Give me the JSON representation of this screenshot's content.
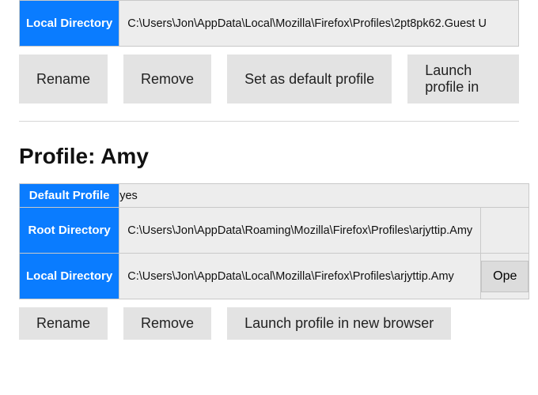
{
  "profiles": [
    {
      "heading": "",
      "rows": {
        "root_directory_label": "",
        "root_directory_value": "",
        "local_directory_label": "Local Directory",
        "local_directory_value": "C:\\Users\\Jon\\AppData\\Local\\Mozilla\\Firefox\\Profiles\\2pt8pk62.Guest U"
      },
      "buttons": {
        "rename": "Rename",
        "remove": "Remove",
        "set_default": "Set as default profile",
        "launch": "Launch profile in"
      }
    },
    {
      "heading": "Profile: Amy",
      "rows": {
        "default_profile_label": "Default Profile",
        "default_profile_value": "yes",
        "root_directory_label": "Root Directory",
        "root_directory_value": "C:\\Users\\Jon\\AppData\\Roaming\\Mozilla\\Firefox\\Profiles\\arjyttip.Amy",
        "local_directory_label": "Local Directory",
        "local_directory_value": "C:\\Users\\Jon\\AppData\\Local\\Mozilla\\Firefox\\Profiles\\arjyttip.Amy",
        "open_button": "Ope"
      },
      "buttons": {
        "rename": "Rename",
        "remove": "Remove",
        "launch": "Launch profile in new browser"
      }
    }
  ]
}
